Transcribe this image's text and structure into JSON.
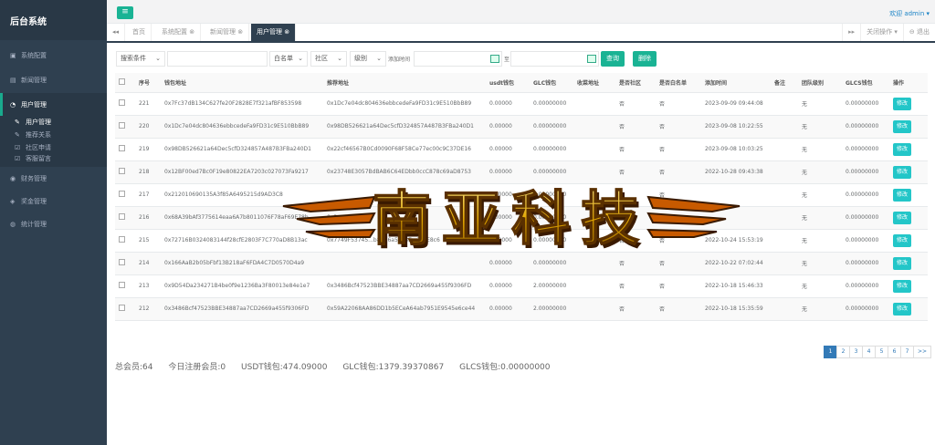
{
  "brand": "后台系统",
  "nav": [
    {
      "label": "系统配置",
      "icon": "config-icon"
    },
    {
      "label": "新闻管理",
      "icon": "news-icon"
    },
    {
      "label": "用户管理",
      "icon": "users-icon",
      "sub": [
        {
          "label": "用户管理",
          "icon": "wrench-icon"
        },
        {
          "label": "推荐关系",
          "icon": "wrench-icon"
        },
        {
          "label": "社区申请",
          "icon": "edit-icon"
        },
        {
          "label": "客服留言",
          "icon": "edit-icon"
        }
      ]
    },
    {
      "label": "财务管理",
      "icon": "finance-icon"
    },
    {
      "label": "奖金管理",
      "icon": "bonus-icon"
    },
    {
      "label": "统计管理",
      "icon": "stats-icon"
    }
  ],
  "topbar": {
    "welcome": "欢迎 admin ▾"
  },
  "tabs": [
    "首页",
    "系统配置 ⊗",
    "新闻管理 ⊗",
    "用户管理 ⊗"
  ],
  "tab_tools": {
    "close_ops": "关闭操作 ▾",
    "logout": "⊖ 退出"
  },
  "search": {
    "condition": "搜索条件",
    "whitelist": "白名单",
    "community": "社区",
    "level": "级别",
    "time_label": "添加时间",
    "to": "至",
    "query": "查询",
    "delete": "删除"
  },
  "table": {
    "headers": [
      "",
      "序号",
      "钱包地址",
      "推荐地址",
      "usdt钱包",
      "GLC钱包",
      "收菜地址",
      "是否社区",
      "是否白名单",
      "添加时间",
      "备注",
      "团队级别",
      "GLCS钱包",
      "操作"
    ],
    "rows": [
      [
        "221",
        "0x7Fc37dB134C627fe20F2828E7f321afBF853598",
        "0x1Dc7e04dc804636ebbcedeFa9FD31c9E510BbB89",
        "0.00000",
        "0.00000000",
        "",
        "否",
        "否",
        "2023-09-09 09:44:08",
        "",
        "无",
        "0.00000000"
      ],
      [
        "220",
        "0x1Dc7e04dc804636ebbcedeFa9FD31c9E510BbB89",
        "0x98DB526621a64Dec5cfD324857A487B3FBa240D1",
        "0.00000",
        "0.00000000",
        "",
        "否",
        "否",
        "2023-09-08 10:22:55",
        "",
        "无",
        "0.00000000"
      ],
      [
        "219",
        "0x98DB526621a64Dec5cfD324857A487B3FBa240D1",
        "0x22cf46567B0Cd0090F68F58Ce77ec00c9C37DE16",
        "0.00000",
        "0.00000000",
        "",
        "否",
        "否",
        "2023-09-08 10:03:25",
        "",
        "无",
        "0.00000000"
      ],
      [
        "218",
        "0x12BF00ed7Bc0F19e80822EA7203c027073Fa9217",
        "0x23748E3057BdBAB6C64EDbb0ccC878c69aD8753",
        "0.00000",
        "0.00000000",
        "",
        "否",
        "否",
        "2022-10-28 09:43:38",
        "",
        "无",
        "0.00000000"
      ],
      [
        "217",
        "0x212010690135A3f85A6495215d9AD3C8",
        "",
        "0.00000",
        "0.00000000",
        "",
        "否",
        "否",
        "",
        "",
        "无",
        "0.00000000"
      ],
      [
        "216",
        "0x68A39bAf3775614eaa6A7b8011076F78aF69E78b",
        "0x3...348",
        "0.00000",
        "0.00000000",
        "",
        "否",
        "否",
        "",
        "",
        "无",
        "0.00000000"
      ],
      [
        "215",
        "0x72716B0324083144f28cfE2803F7C770aD8B13ac",
        "0x7749F53745...b8A06a54e8E...7rCE8c6",
        "0.00000",
        "0.00000000",
        "",
        "否",
        "否",
        "2022-10-24 15:53:19",
        "",
        "无",
        "0.00000000"
      ],
      [
        "214",
        "0x166AaB2b05bFbf13B218aF6FDA4C7D0570D4a9",
        "",
        "0.00000",
        "0.00000000",
        "",
        "否",
        "否",
        "2022-10-22 07:02:44",
        "",
        "无",
        "0.00000000"
      ],
      [
        "213",
        "0x9D54Da234271B4be0f9e1236Ba3F80013e84e1e7",
        "0x3486Bcf47523BBE34887aa7CD2669a455f9306FD",
        "0.00000",
        "2.00000000",
        "",
        "否",
        "否",
        "2022-10-18 15:46:33",
        "",
        "无",
        "0.00000000"
      ],
      [
        "212",
        "0x3486Bcf47523BBE34887aa7CD2669a455f9306FD",
        "0x59A22068AA86DD1b5ECeA64ab7951E9545e6ce44",
        "0.00000",
        "2.00000000",
        "",
        "否",
        "否",
        "2022-10-18 15:35:59",
        "",
        "无",
        "0.00000000"
      ]
    ],
    "edit_label": "修改"
  },
  "pager": [
    "1",
    "2",
    "3",
    "4",
    "5",
    "6",
    "7",
    ">>"
  ],
  "stats": {
    "members": "总会员:64",
    "today": "今日注册会员:0",
    "usdt": "USDT钱包:474.09000",
    "glc": "GLC钱包:1379.39370867",
    "glcs": "GLCS钱包:0.00000000"
  },
  "watermark": "南亚科技",
  "colors": {
    "sidebar": "#2f4050",
    "accent": "#1ab394",
    "edit": "#23c6c8",
    "watermark": "#f2b705"
  }
}
